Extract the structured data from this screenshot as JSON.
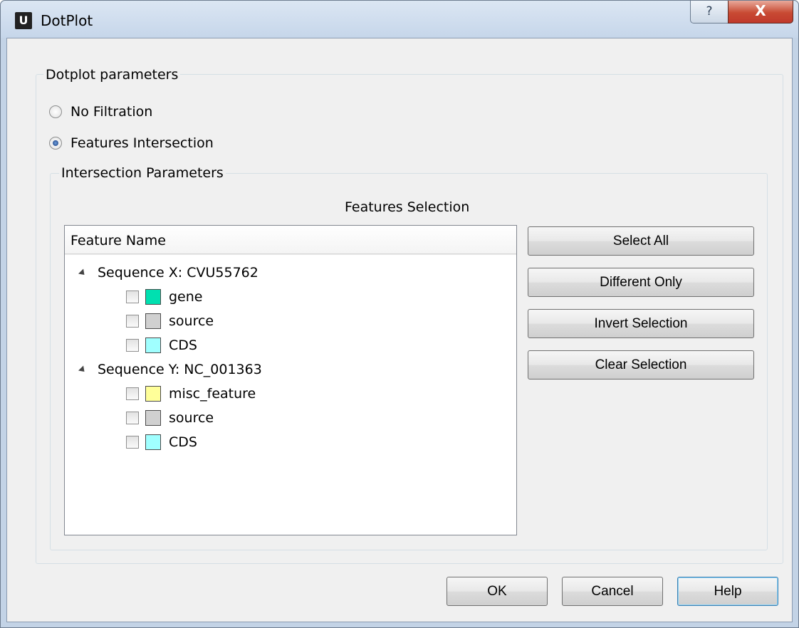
{
  "window": {
    "title": "DotPlot",
    "app_icon_letter": "U",
    "help_glyph": "?",
    "close_glyph": "X"
  },
  "params_group": {
    "title": "Dotplot parameters",
    "radios": [
      {
        "label": "No Filtration",
        "checked": false
      },
      {
        "label": "Features Intersection",
        "checked": true
      }
    ]
  },
  "intersection_group": {
    "title": "Intersection Parameters",
    "caption": "Features Selection",
    "tree": {
      "header": "Feature Name",
      "sequences": [
        {
          "label": "Sequence X: CVU55762",
          "features": [
            {
              "name": "gene",
              "color": "#00e0b0",
              "checked": false
            },
            {
              "name": "source",
              "color": "#d0d0d0",
              "checked": false
            },
            {
              "name": "CDS",
              "color": "#a0ffff",
              "checked": false
            }
          ]
        },
        {
          "label": "Sequence Y: NC_001363",
          "features": [
            {
              "name": "misc_feature",
              "color": "#ffff99",
              "checked": false
            },
            {
              "name": "source",
              "color": "#d0d0d0",
              "checked": false
            },
            {
              "name": "CDS",
              "color": "#a0ffff",
              "checked": false
            }
          ]
        }
      ]
    },
    "buttons": {
      "select_all": "Select All",
      "different_only": "Different Only",
      "invert_selection": "Invert Selection",
      "clear_selection": "Clear Selection"
    }
  },
  "footer": {
    "ok": "OK",
    "cancel": "Cancel",
    "help": "Help"
  }
}
